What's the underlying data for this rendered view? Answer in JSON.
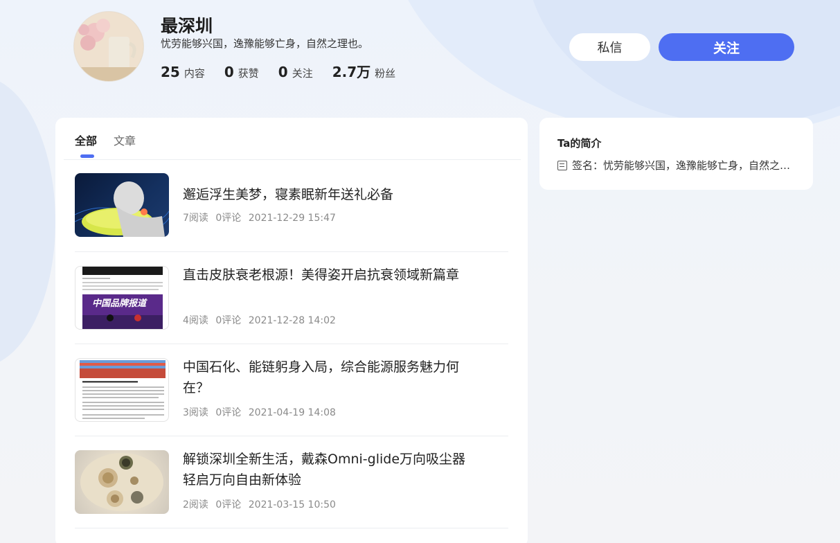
{
  "profile": {
    "name": "最深圳",
    "bio": "忧劳能够兴国，逸豫能够亡身，自然之理也。",
    "stats": [
      {
        "num": "25",
        "label": "内容"
      },
      {
        "num": "0",
        "label": "获赞"
      },
      {
        "num": "0",
        "label": "关注"
      },
      {
        "num": "2.7万",
        "label": "粉丝"
      }
    ],
    "message_label": "私信",
    "follow_label": "关注"
  },
  "tabs": [
    {
      "label": "全部",
      "active": true
    },
    {
      "label": "文章",
      "active": false
    }
  ],
  "articles": [
    {
      "title": "邂逅浮生美梦，寝素眠新年送礼必备",
      "reads": "7阅读",
      "comments": "0评论",
      "time": "2021-12-29 15:47"
    },
    {
      "title": "直击皮肤衰老根源！美得姿开启抗衰领域新篇章",
      "reads": "4阅读",
      "comments": "0评论",
      "time": "2021-12-28 14:02"
    },
    {
      "title": "中国石化、能链躬身入局，综合能源服务魅力何在？",
      "reads": "3阅读",
      "comments": "0评论",
      "time": "2021-04-19 14:08"
    },
    {
      "title": "解锁深圳全新生活，戴森Omni-glide万向吸尘器轻启万向自由新体验",
      "reads": "2阅读",
      "comments": "0评论",
      "time": "2021-03-15 10:50"
    }
  ],
  "thumb_texts": {
    "brand_report": "中国品牌报道"
  },
  "intro": {
    "title": "Ta的简介",
    "sign": "签名：忧劳能够兴国，逸豫能够亡身，自然之理也。"
  },
  "colors": {
    "accent": "#4e6ef2"
  }
}
